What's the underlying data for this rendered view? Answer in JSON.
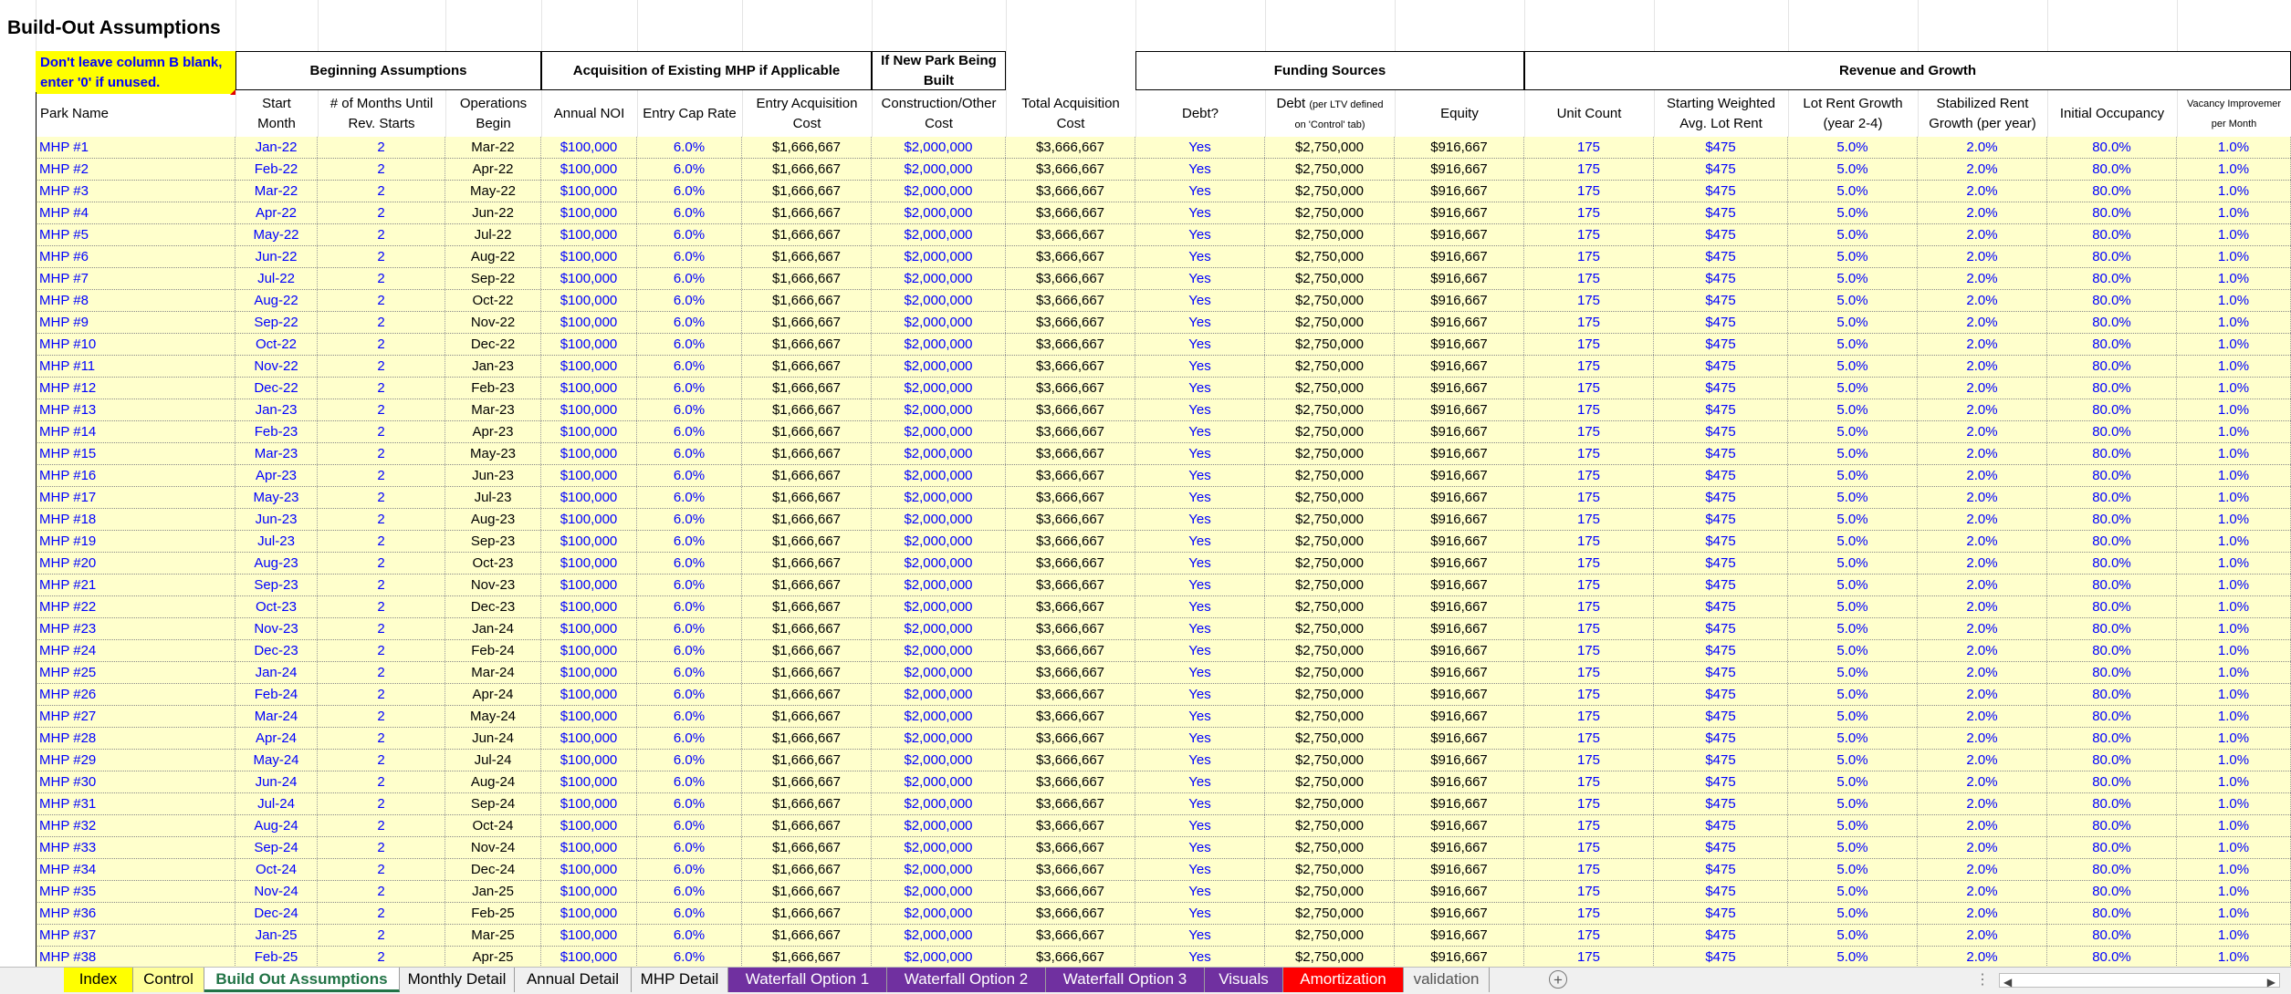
{
  "sheet": {
    "title": "Build-Out Assumptions",
    "note": [
      "Don't leave column B blank,",
      "enter '0' if unused."
    ],
    "groups": {
      "beginning": "Beginning Assumptions",
      "acquisition": "Acquisition of Existing MHP if Applicable",
      "new_park": [
        "If New Park Being",
        "Built"
      ],
      "funding": "Funding Sources",
      "revenue": "Revenue and Growth"
    },
    "headers": {
      "park_name": "Park Name",
      "start_month": [
        "Start",
        "Month"
      ],
      "months_until": [
        "# of Months Until",
        "Rev. Starts"
      ],
      "ops_begin": [
        "Operations",
        "Begin"
      ],
      "annual_noi": "Annual NOI",
      "entry_cap": "Entry Cap Rate",
      "entry_cost": [
        "Entry Acquisition",
        "Cost"
      ],
      "construction": [
        "Construction/Other",
        "Cost"
      ],
      "total_cost": [
        "Total Acquisition",
        "Cost"
      ],
      "debt_q": "Debt?",
      "debt": [
        "Debt",
        "(per LTV defined",
        "on 'Control' tab)"
      ],
      "equity": "Equity",
      "unit_count": "Unit Count",
      "lot_rent": [
        "Starting Weighted",
        "Avg. Lot Rent"
      ],
      "lot_growth": [
        "Lot Rent Growth",
        "(year 2-4)"
      ],
      "stab_growth": [
        "Stabilized Rent",
        "Growth (per year)"
      ],
      "init_occ": "Initial Occupancy",
      "vacancy": [
        "Vacancy Improvemer",
        "per Month"
      ]
    },
    "rows": [
      [
        "MHP #1",
        "Jan-22",
        "Mar-22"
      ],
      [
        "MHP #2",
        "Feb-22",
        "Apr-22"
      ],
      [
        "MHP #3",
        "Mar-22",
        "May-22"
      ],
      [
        "MHP #4",
        "Apr-22",
        "Jun-22"
      ],
      [
        "MHP #5",
        "May-22",
        "Jul-22"
      ],
      [
        "MHP #6",
        "Jun-22",
        "Aug-22"
      ],
      [
        "MHP #7",
        "Jul-22",
        "Sep-22"
      ],
      [
        "MHP #8",
        "Aug-22",
        "Oct-22"
      ],
      [
        "MHP #9",
        "Sep-22",
        "Nov-22"
      ],
      [
        "MHP #10",
        "Oct-22",
        "Dec-22"
      ],
      [
        "MHP #11",
        "Nov-22",
        "Jan-23"
      ],
      [
        "MHP #12",
        "Dec-22",
        "Feb-23"
      ],
      [
        "MHP #13",
        "Jan-23",
        "Mar-23"
      ],
      [
        "MHP #14",
        "Feb-23",
        "Apr-23"
      ],
      [
        "MHP #15",
        "Mar-23",
        "May-23"
      ],
      [
        "MHP #16",
        "Apr-23",
        "Jun-23"
      ],
      [
        "MHP #17",
        "May-23",
        "Jul-23"
      ],
      [
        "MHP #18",
        "Jun-23",
        "Aug-23"
      ],
      [
        "MHP #19",
        "Jul-23",
        "Sep-23"
      ],
      [
        "MHP #20",
        "Aug-23",
        "Oct-23"
      ],
      [
        "MHP #21",
        "Sep-23",
        "Nov-23"
      ],
      [
        "MHP #22",
        "Oct-23",
        "Dec-23"
      ],
      [
        "MHP #23",
        "Nov-23",
        "Jan-24"
      ],
      [
        "MHP #24",
        "Dec-23",
        "Feb-24"
      ],
      [
        "MHP #25",
        "Jan-24",
        "Mar-24"
      ],
      [
        "MHP #26",
        "Feb-24",
        "Apr-24"
      ],
      [
        "MHP #27",
        "Mar-24",
        "May-24"
      ],
      [
        "MHP #28",
        "Apr-24",
        "Jun-24"
      ],
      [
        "MHP #29",
        "May-24",
        "Jul-24"
      ],
      [
        "MHP #30",
        "Jun-24",
        "Aug-24"
      ],
      [
        "MHP #31",
        "Jul-24",
        "Sep-24"
      ],
      [
        "MHP #32",
        "Aug-24",
        "Oct-24"
      ],
      [
        "MHP #33",
        "Sep-24",
        "Nov-24"
      ],
      [
        "MHP #34",
        "Oct-24",
        "Dec-24"
      ],
      [
        "MHP #35",
        "Nov-24",
        "Jan-25"
      ],
      [
        "MHP #36",
        "Dec-24",
        "Feb-25"
      ],
      [
        "MHP #37",
        "Jan-25",
        "Mar-25"
      ],
      [
        "MHP #38",
        "Feb-25",
        "Apr-25"
      ]
    ],
    "common": {
      "months_until": "2",
      "annual_noi": "$100,000",
      "entry_cap": "6.0%",
      "entry_cost": "$1,666,667",
      "construction": "$2,000,000",
      "total_cost": "$3,666,667",
      "debt_q": "Yes",
      "debt": "$2,750,000",
      "equity": "$916,667",
      "unit_count": "175",
      "lot_rent": "$475",
      "lot_growth": "5.0%",
      "stab_growth": "2.0%",
      "init_occ": "80.0%",
      "vacancy": "1.0%"
    }
  },
  "tabs": [
    {
      "label": "Index",
      "bg": "#ffff00",
      "color": "#000000"
    },
    {
      "label": "Control",
      "bg": "#ffff99",
      "color": "#000000"
    },
    {
      "label": "Build Out Assumptions",
      "bg": "#ffffff",
      "color": "#217346",
      "active": true
    },
    {
      "label": "Monthly Detail",
      "bg": "#f0f0f0",
      "color": "#000000"
    },
    {
      "label": "Annual Detail",
      "bg": "#f0f0f0",
      "color": "#000000"
    },
    {
      "label": "MHP Detail",
      "bg": "#f0f0f0",
      "color": "#000000"
    },
    {
      "label": "Waterfall Option 1",
      "bg": "#7030a0",
      "color": "#ffffff"
    },
    {
      "label": "Waterfall Option 2",
      "bg": "#7030a0",
      "color": "#ffffff"
    },
    {
      "label": "Waterfall Option 3",
      "bg": "#7030a0",
      "color": "#ffffff"
    },
    {
      "label": "Visuals",
      "bg": "#7030a0",
      "color": "#ffffff"
    },
    {
      "label": "Amortization",
      "bg": "#ff0000",
      "color": "#ffffff"
    },
    {
      "label": "validation",
      "bg": "#f0f0f0",
      "color": "#555555"
    }
  ],
  "icons": {
    "add_sheet": "plus-circle-icon",
    "scroll_left": "◀",
    "scroll_right": "▶",
    "more": "⋮"
  }
}
